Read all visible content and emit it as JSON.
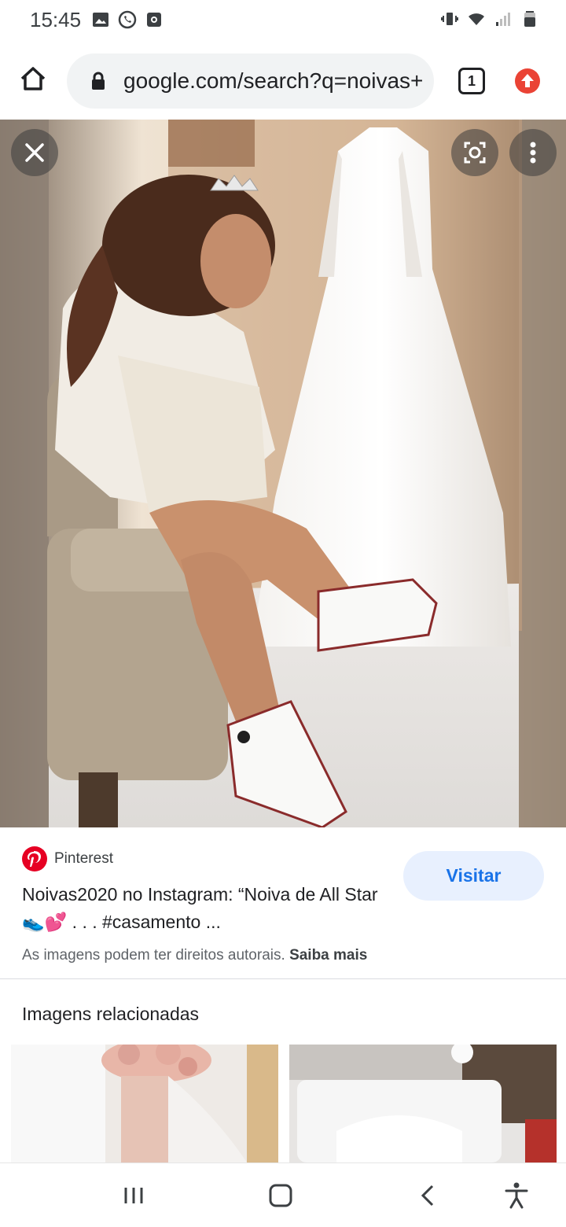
{
  "status_bar": {
    "time": "15:45",
    "left_icons": [
      "image-icon",
      "whatsapp-icon",
      "camera-notification-icon"
    ],
    "right_icons": [
      "vibrate-icon",
      "wifi-icon",
      "signal-icon",
      "battery-icon"
    ]
  },
  "browser": {
    "url": "google.com/search?q=noivas+",
    "tab_count": "1"
  },
  "viewer": {
    "close_icon": "close-icon",
    "lens_icon": "google-lens-icon",
    "more_icon": "more-vert-icon"
  },
  "result": {
    "source": "Pinterest",
    "title": "Noivas2020 no Instagram: “Noiva de All Star 👟💕 . . . #casamento ...",
    "visit_label": "Visitar",
    "copyright_text": "As imagens podem ter direitos autorais.",
    "learn_more": "Saiba mais"
  },
  "related": {
    "title": "Imagens relacionadas"
  },
  "navbar": {
    "icons": [
      "recent-apps-icon",
      "home-icon",
      "back-icon",
      "accessibility-icon"
    ]
  },
  "colors": {
    "accent_blue": "#1a73e8",
    "visit_bg": "#e8f0fe",
    "pinterest_red": "#e60023",
    "update_red": "#ea4335"
  }
}
